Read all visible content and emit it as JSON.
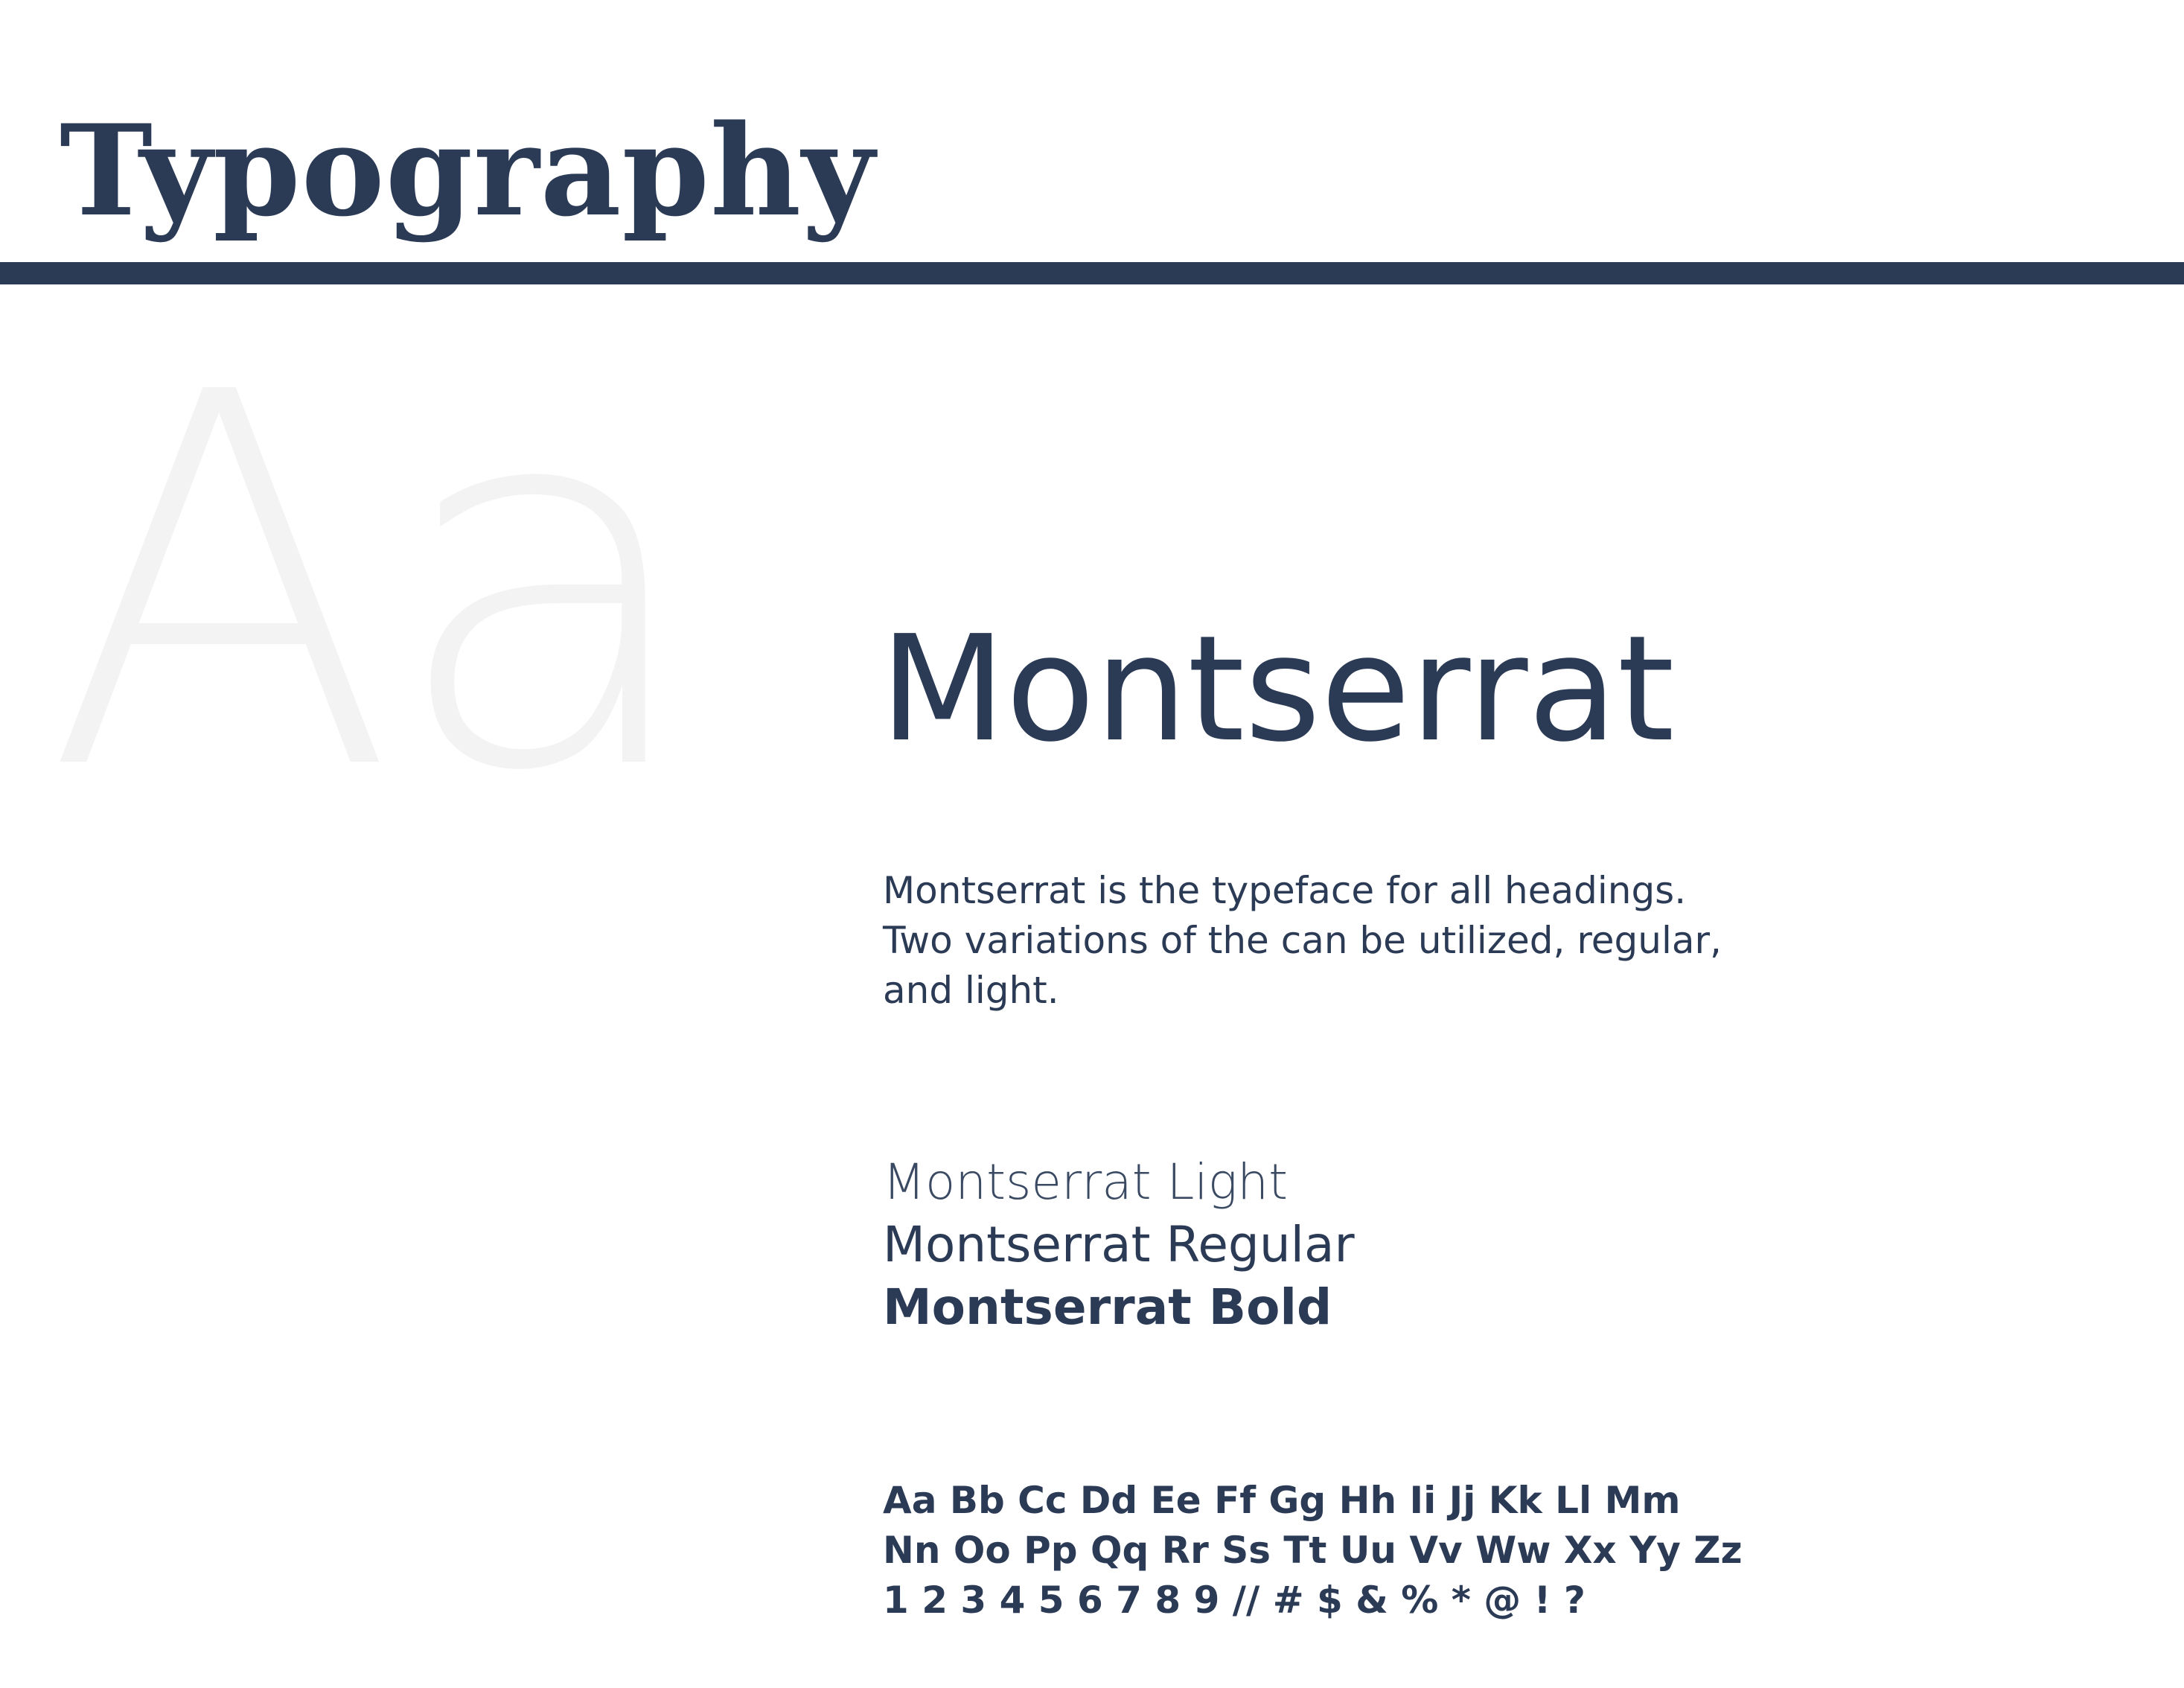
{
  "header": {
    "title": "Typography"
  },
  "watermark": {
    "text": "Aa"
  },
  "font": {
    "name": "Montserrat",
    "description_lines": [
      "Montserrat is the typeface for all headings.",
      "Two variations of the can be utilized, regular,",
      "and light."
    ],
    "weights": [
      "Montserrat Light",
      "Montserrat Regular",
      "Montserrat Bold"
    ]
  },
  "charset": {
    "lines": [
      "Aa Bb Cc Dd Ee Ff Gg Hh Ii Jj Kk Ll Mm",
      "Nn Oo Pp Qq Rr Ss Tt Uu Vv Ww Xx Yy Zz",
      "1 2 3 4 5 6 7 8 9  //  # $ & % * @ ! ?"
    ]
  },
  "colors": {
    "primary": "#2b3a55",
    "watermark": "#f3f3f3",
    "background": "#ffffff"
  }
}
